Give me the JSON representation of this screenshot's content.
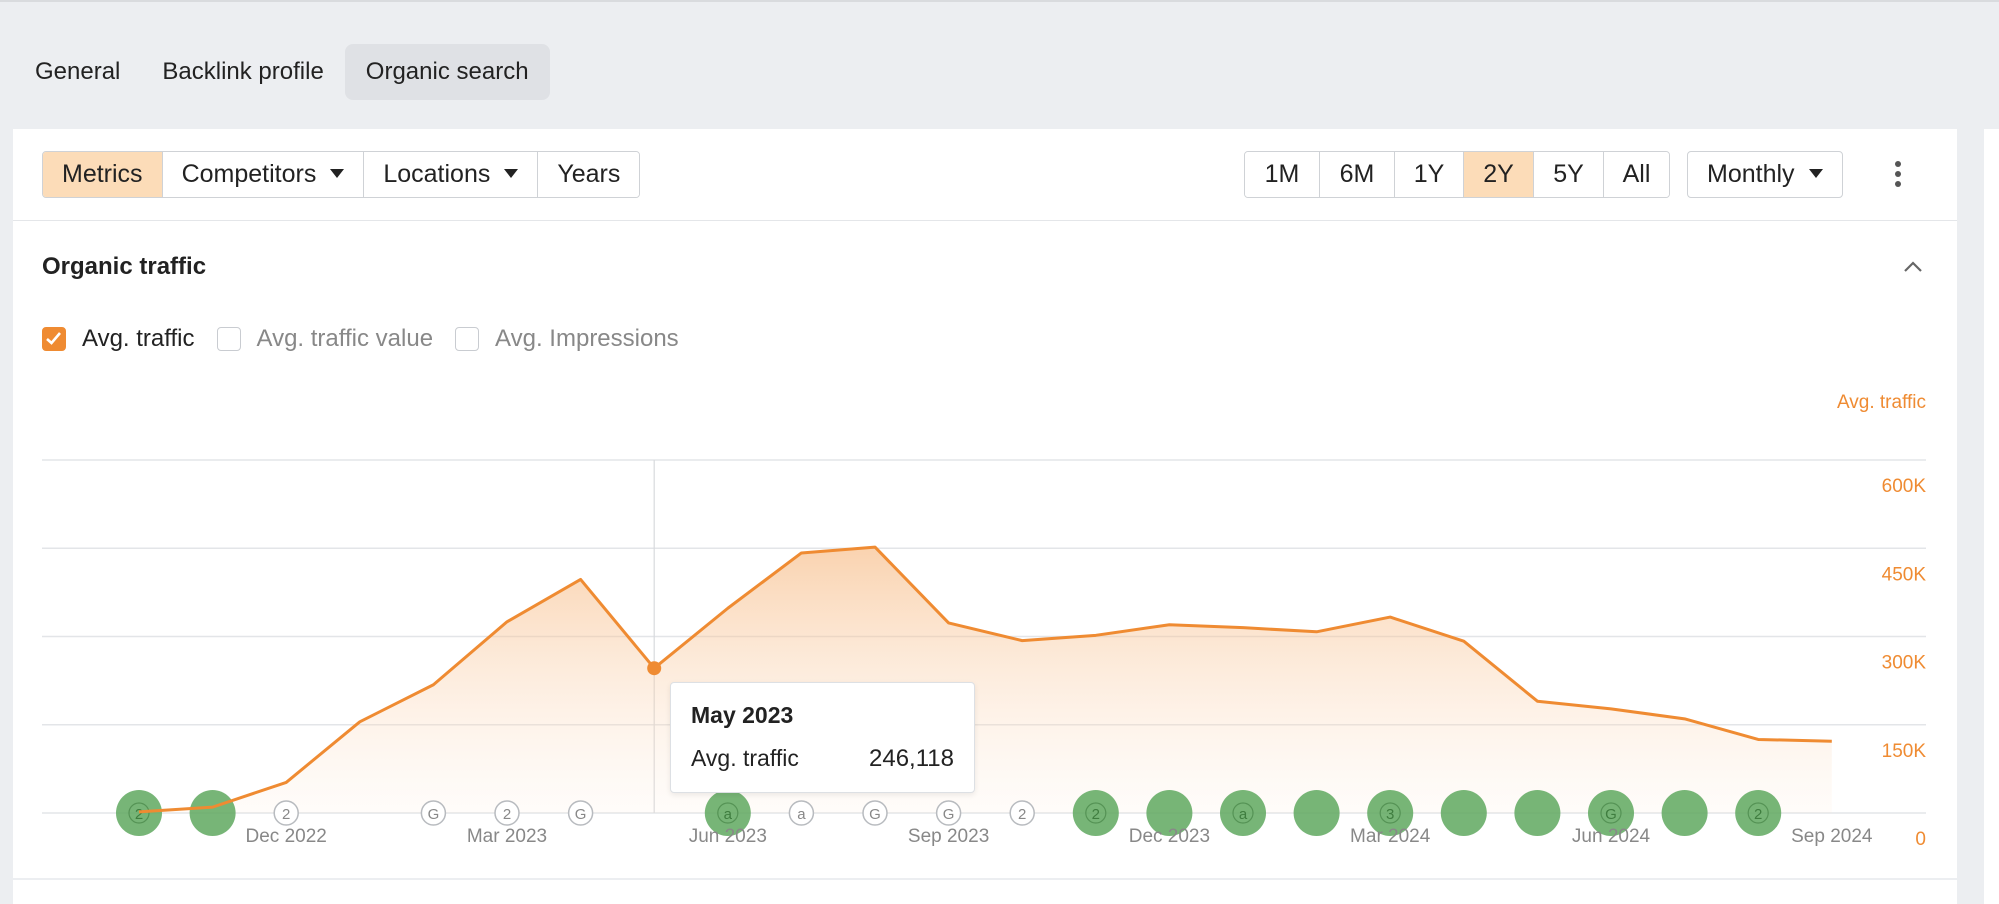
{
  "page_tabs": [
    {
      "label": "General",
      "active": false
    },
    {
      "label": "Backlink profile",
      "active": false
    },
    {
      "label": "Organic search",
      "active": true
    }
  ],
  "toolbar": {
    "view_buttons": [
      {
        "label": "Metrics",
        "active": true,
        "dropdown": false
      },
      {
        "label": "Competitors",
        "active": false,
        "dropdown": true
      },
      {
        "label": "Locations",
        "active": false,
        "dropdown": true
      },
      {
        "label": "Years",
        "active": false,
        "dropdown": false
      }
    ],
    "periods": [
      {
        "label": "1M",
        "active": false
      },
      {
        "label": "6M",
        "active": false
      },
      {
        "label": "1Y",
        "active": false
      },
      {
        "label": "2Y",
        "active": true
      },
      {
        "label": "5Y",
        "active": false
      },
      {
        "label": "All",
        "active": false
      }
    ],
    "granularity": "Monthly"
  },
  "section": {
    "title": "Organic traffic",
    "metrics": [
      {
        "label": "Avg. traffic",
        "checked": true
      },
      {
        "label": "Avg. traffic value",
        "checked": false
      },
      {
        "label": "Avg. Impressions",
        "checked": false
      }
    ]
  },
  "tooltip": {
    "title": "May 2023",
    "label": "Avg. traffic",
    "value": "246,118"
  },
  "colors": {
    "accent": "#ef8b32",
    "active_bg": "#fcdcb8",
    "marker_green": "#5fa85f"
  },
  "chart_data": {
    "type": "area",
    "ylabel": "Avg. traffic",
    "ylim": [
      0,
      600000
    ],
    "yticks": [
      0,
      150000,
      300000,
      450000,
      600000
    ],
    "ytick_labels": [
      "0",
      "150K",
      "300K",
      "450K",
      "600K"
    ],
    "xtick_labels": [
      "Dec 2022",
      "Mar 2023",
      "Jun 2023",
      "Sep 2023",
      "Dec 2023",
      "Mar 2024",
      "Jun 2024",
      "Sep 2024"
    ],
    "x": [
      "Oct 2022",
      "Nov 2022",
      "Dec 2022",
      "Jan 2023",
      "Feb 2023",
      "Mar 2023",
      "Apr 2023",
      "May 2023",
      "Jun 2023",
      "Jul 2023",
      "Aug 2023",
      "Sep 2023",
      "Oct 2023",
      "Nov 2023",
      "Dec 2023",
      "Jan 2024",
      "Feb 2024",
      "Mar 2024",
      "Apr 2024",
      "May 2024",
      "Jun 2024",
      "Jul 2024",
      "Aug 2024",
      "Sep 2024"
    ],
    "series": [
      {
        "name": "Avg. traffic",
        "values": [
          2000,
          10000,
          52000,
          155000,
          218000,
          325000,
          397000,
          246118,
          348000,
          442000,
          452000,
          323000,
          293000,
          302000,
          320000,
          315000,
          308000,
          333000,
          292000,
          190000,
          177000,
          160000,
          125000,
          122000
        ]
      }
    ],
    "highlighted": "May 2023",
    "grid": true,
    "annotations": [
      {
        "x": "Oct 2022",
        "glyph": "2",
        "style": "filled"
      },
      {
        "x": "Nov 2022",
        "glyph": "",
        "style": "filled"
      },
      {
        "x": "Dec 2022",
        "glyph": "2",
        "style": "outline"
      },
      {
        "x": "Feb 2023",
        "glyph": "G",
        "style": "outline"
      },
      {
        "x": "Mar 2023",
        "glyph": "2",
        "style": "outline"
      },
      {
        "x": "Apr 2023",
        "glyph": "G",
        "style": "outline"
      },
      {
        "x": "Jun 2023",
        "glyph": "a",
        "style": "filled"
      },
      {
        "x": "Jul 2023",
        "glyph": "a",
        "style": "outline"
      },
      {
        "x": "Aug 2023",
        "glyph": "G",
        "style": "outline"
      },
      {
        "x": "Sep 2023",
        "glyph": "G",
        "style": "outline"
      },
      {
        "x": "Oct 2023",
        "glyph": "2",
        "style": "outline"
      },
      {
        "x": "Nov 2023",
        "glyph": "2",
        "style": "filled"
      },
      {
        "x": "Dec 2023",
        "glyph": "",
        "style": "filled"
      },
      {
        "x": "Jan 2024",
        "glyph": "a",
        "style": "filled"
      },
      {
        "x": "Feb 2024",
        "glyph": "",
        "style": "filled"
      },
      {
        "x": "Mar 2024",
        "glyph": "3",
        "style": "filled"
      },
      {
        "x": "Apr 2024",
        "glyph": "",
        "style": "filled"
      },
      {
        "x": "May 2024",
        "glyph": "",
        "style": "filled"
      },
      {
        "x": "Jun 2024",
        "glyph": "G",
        "style": "filled"
      },
      {
        "x": "Jul 2024",
        "glyph": "",
        "style": "filled"
      },
      {
        "x": "Aug 2024",
        "glyph": "2",
        "style": "filled"
      }
    ]
  }
}
